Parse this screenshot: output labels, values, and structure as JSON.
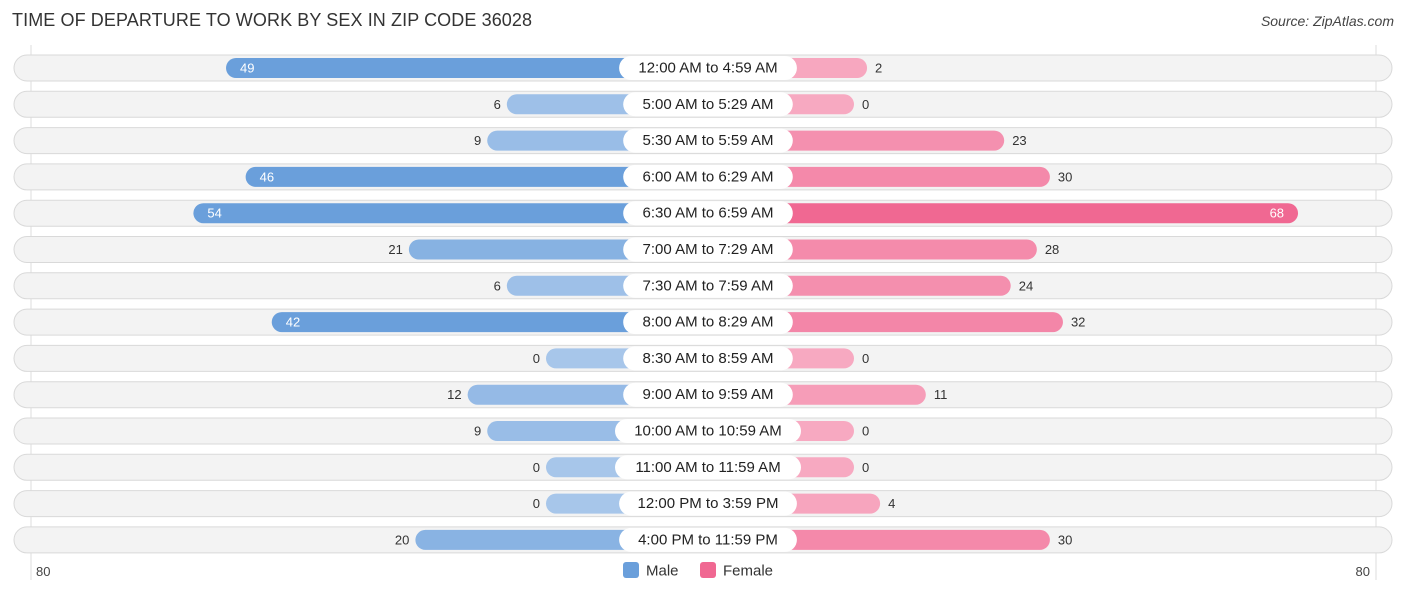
{
  "header": {
    "title": "TIME OF DEPARTURE TO WORK BY SEX IN ZIP CODE 36028",
    "source": "Source: ZipAtlas.com"
  },
  "colors": {
    "male_strong": "#6a9fdb",
    "male_light": "#a7c6ea",
    "female_strong": "#f06892",
    "female_light": "#f7a9c1"
  },
  "chart_data": {
    "type": "bar",
    "orientation": "horizontal-diverging",
    "title": "TIME OF DEPARTURE TO WORK BY SEX IN ZIP CODE 36028",
    "categories": [
      "12:00 AM to 4:59 AM",
      "5:00 AM to 5:29 AM",
      "5:30 AM to 5:59 AM",
      "6:00 AM to 6:29 AM",
      "6:30 AM to 6:59 AM",
      "7:00 AM to 7:29 AM",
      "7:30 AM to 7:59 AM",
      "8:00 AM to 8:29 AM",
      "8:30 AM to 8:59 AM",
      "9:00 AM to 9:59 AM",
      "10:00 AM to 10:59 AM",
      "11:00 AM to 11:59 AM",
      "12:00 PM to 3:59 PM",
      "4:00 PM to 11:59 PM"
    ],
    "series": [
      {
        "name": "Male",
        "values": [
          49,
          6,
          9,
          46,
          54,
          21,
          6,
          42,
          0,
          12,
          9,
          0,
          0,
          20
        ]
      },
      {
        "name": "Female",
        "values": [
          2,
          0,
          23,
          30,
          68,
          28,
          24,
          32,
          0,
          11,
          0,
          0,
          4,
          30
        ]
      }
    ],
    "axis": {
      "left_label": "80",
      "right_label": "80",
      "range": [
        -80,
        80
      ]
    },
    "legend": {
      "position": "bottom-center",
      "items": [
        "Male",
        "Female"
      ]
    },
    "grid": false
  }
}
